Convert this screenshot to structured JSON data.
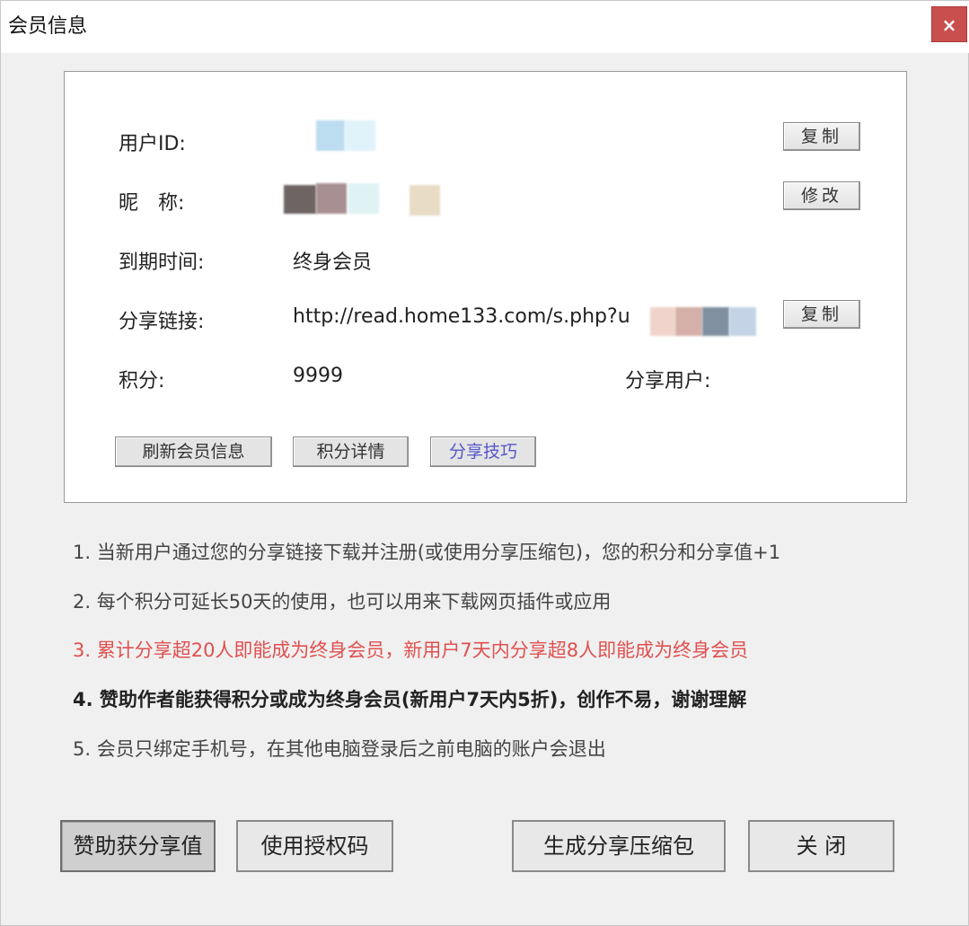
{
  "window": {
    "title": "会员信息",
    "close_glyph": "×"
  },
  "info": {
    "user_id_label": "用户ID:",
    "nickname_label": "昵　称:",
    "expiry_label": "到期时间:",
    "expiry_value": "终身会员",
    "share_link_label": "分享链接:",
    "share_link_value": "http://read.home133.com/s.php?u",
    "points_label": "积分:",
    "points_value": "9999",
    "share_users_label": "分享用户:",
    "copy_id_label": "复制",
    "modify_label": "修改",
    "copy_link_label": "复制",
    "refresh_label": "刷新会员信息",
    "points_detail_label": "积分详情",
    "share_tips_label": "分享技巧"
  },
  "notes": [
    "1. 当新用户通过您的分享链接下载并注册(或使用分享压缩包)，您的积分和分享值+1",
    "2. 每个积分可延长50天的使用，也可以用来下载网页插件或应用",
    "3. 累计分享超20人即能成为终身会员，新用户7天内分享超8人即能成为终身会员",
    "4. 赞助作者能获得积分或成为终身会员(新用户7天内5折)，创作不易，谢谢理解",
    "5. 会员只绑定手机号，在其他电脑登录后之前电脑的账户会退出"
  ],
  "footer": {
    "sponsor_label": "赞助获分享值",
    "auth_code_label": "使用授权码",
    "gen_package_label": "生成分享压缩包",
    "close_label": "关 闭"
  }
}
